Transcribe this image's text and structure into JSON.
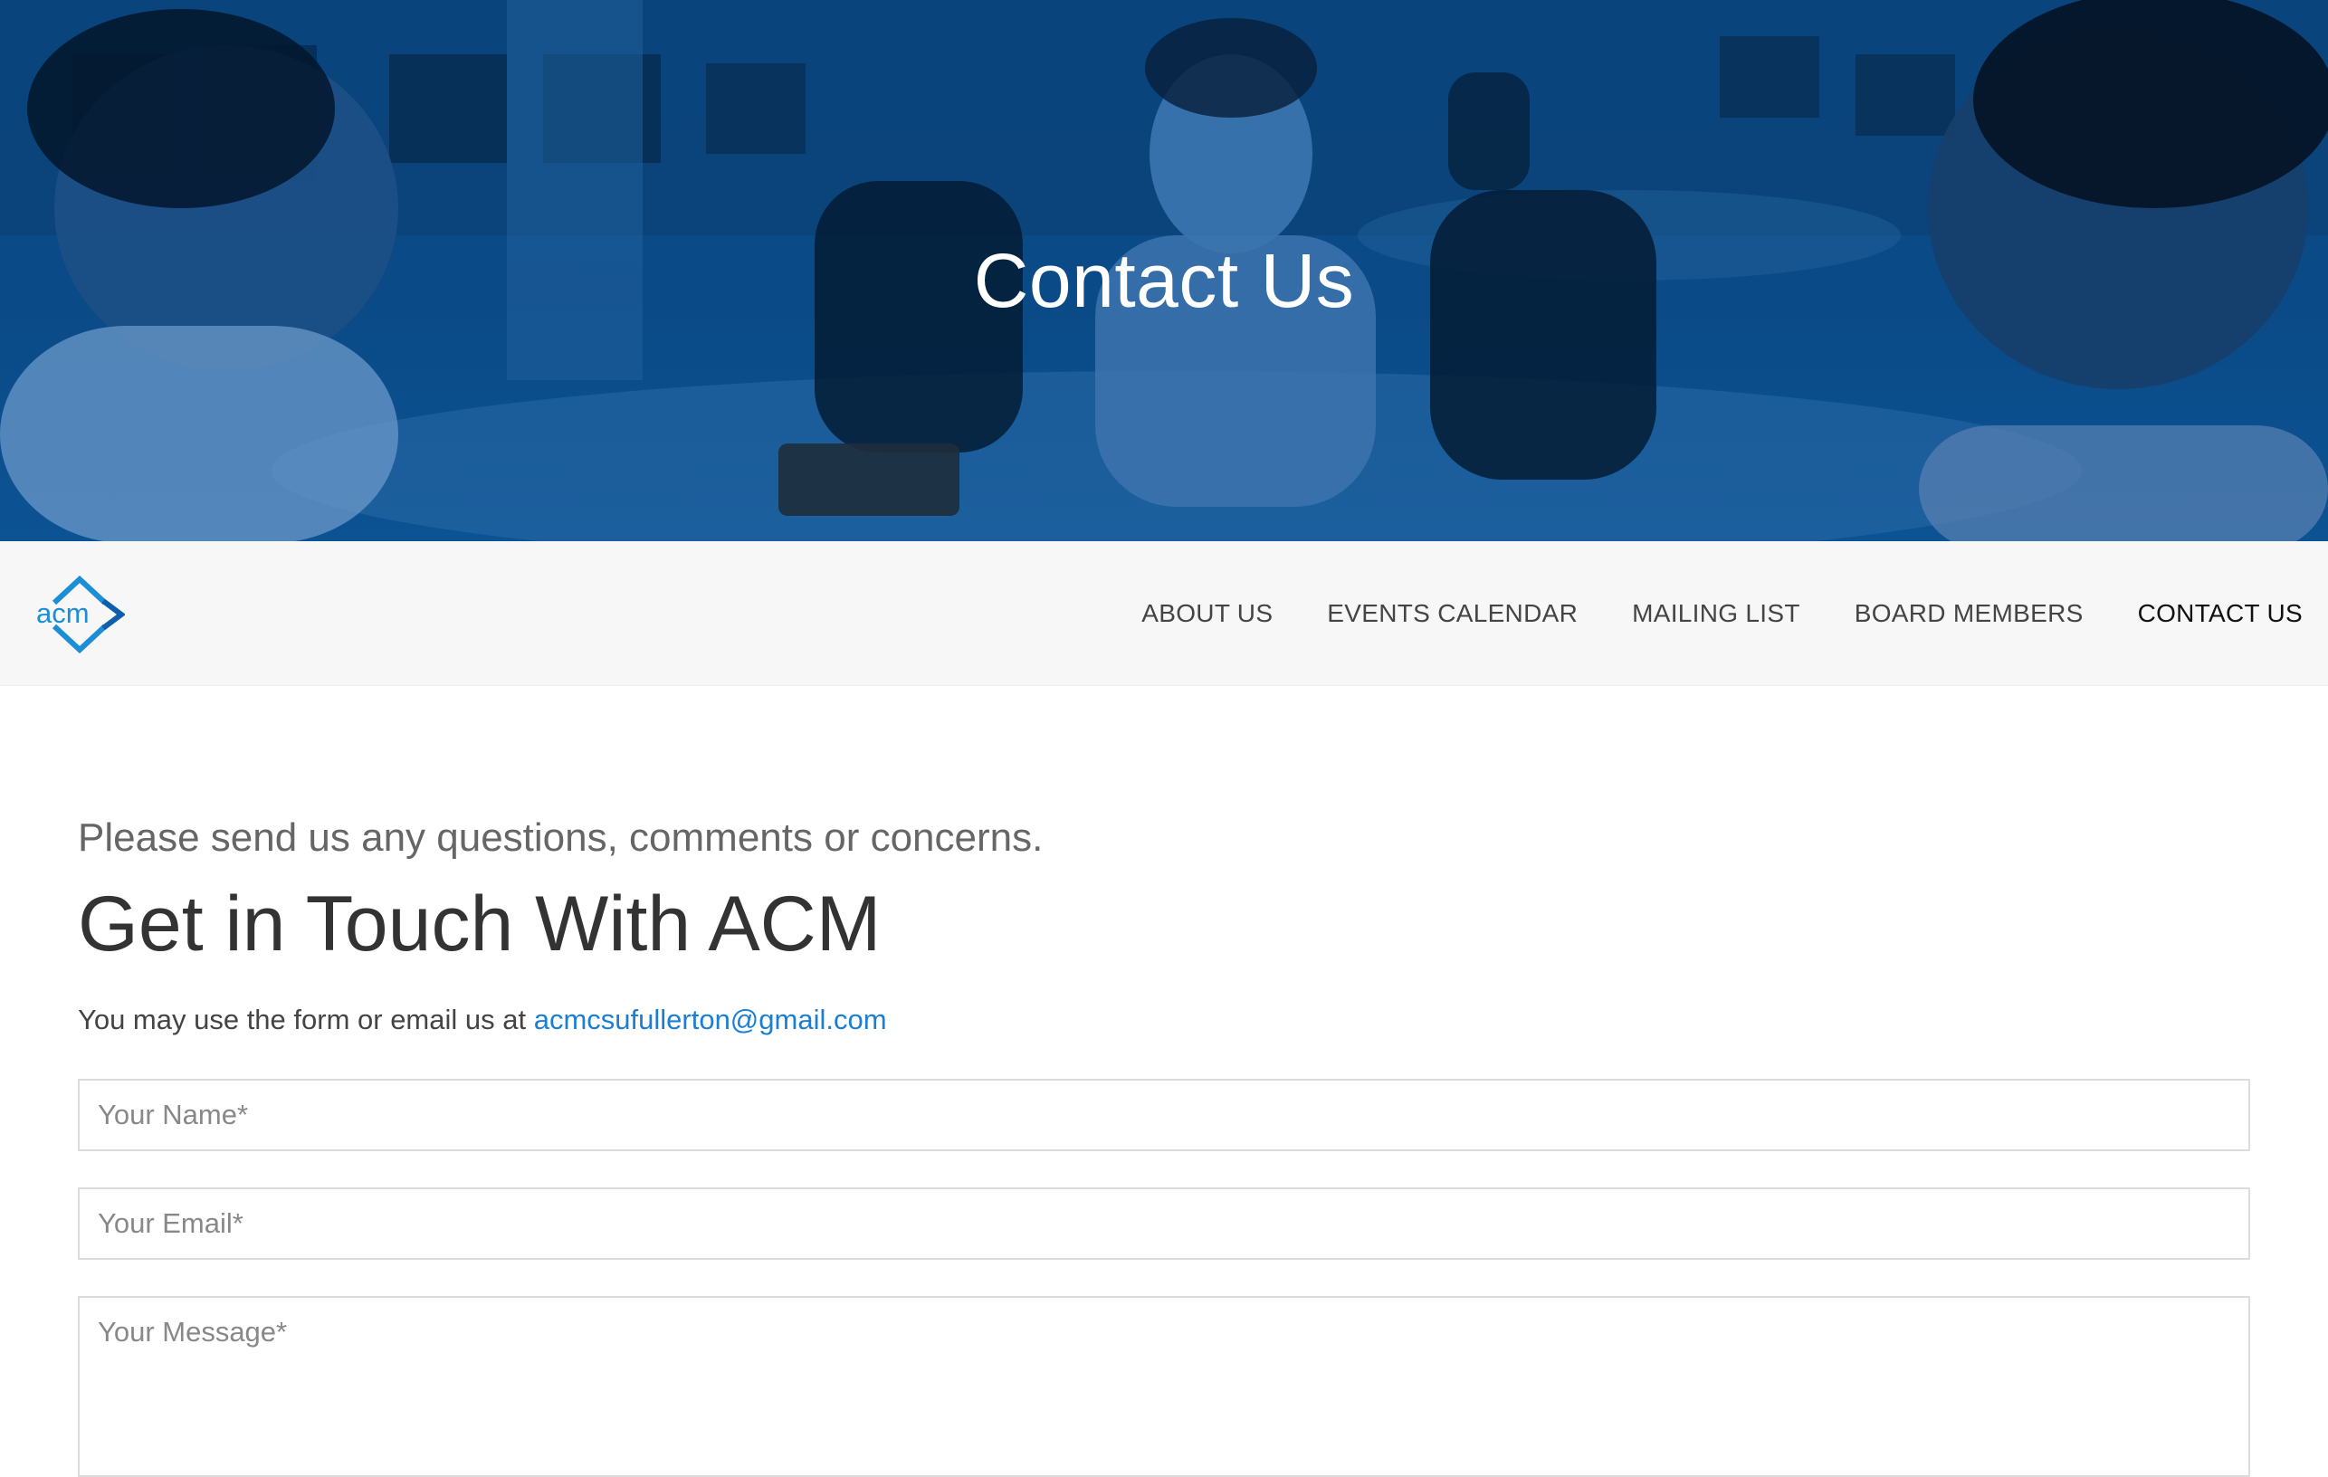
{
  "hero": {
    "title": "Contact Us"
  },
  "brand": {
    "logo_text": "acm",
    "logo_colors": [
      "#1c8ed6",
      "#0d5fae"
    ]
  },
  "nav": {
    "items": [
      {
        "label": "ABOUT US"
      },
      {
        "label": "EVENTS CALENDAR"
      },
      {
        "label": "MAILING LIST"
      },
      {
        "label": "BOARD MEMBERS"
      },
      {
        "label": "CONTACT US",
        "active": true
      }
    ]
  },
  "main": {
    "subheading": "Please send us any questions, comments or concerns.",
    "heading": "Get in Touch With ACM",
    "intro_text": "You may use the form or email us at ",
    "email_link": "acmcsufullerton@gmail.com"
  },
  "form": {
    "name_placeholder": "Your Name*",
    "email_placeholder": "Your Email*",
    "message_placeholder": "Your Message*"
  },
  "colors": {
    "hero_overlay": "#0b4d8a",
    "link": "#1a7fd4",
    "navbar_bg": "#f7f7f7"
  }
}
